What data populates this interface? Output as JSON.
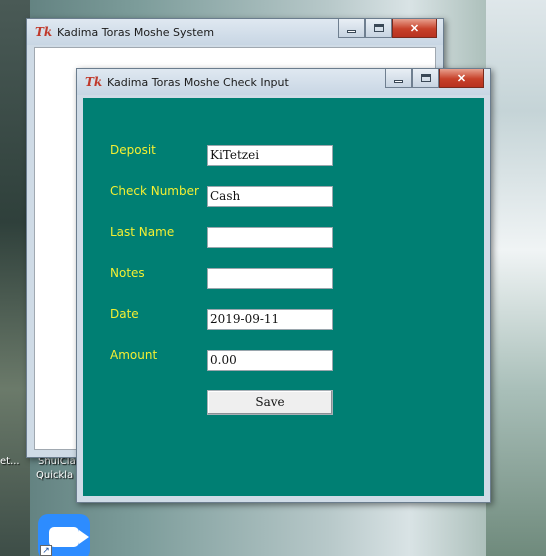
{
  "desktop": {
    "icon_labels": [
      "et...",
      "ShulCla",
      "Quickla"
    ]
  },
  "back_window": {
    "title": "Kadima Toras Moshe System"
  },
  "front_window": {
    "title": "Kadima Toras Moshe Check Input"
  },
  "form": {
    "deposit": {
      "label": "Deposit",
      "value": "KiTetzei"
    },
    "check_number": {
      "label": "Check Number",
      "value": "Cash"
    },
    "last_name": {
      "label": "Last Name",
      "value": ""
    },
    "notes": {
      "label": "Notes",
      "value": ""
    },
    "date": {
      "label": "Date",
      "value": "2019-09-11"
    },
    "amount": {
      "label": "Amount",
      "value": "0.00"
    },
    "save_label": "Save"
  },
  "colors": {
    "form_background": "#007f73",
    "label_text": "#f4ef32",
    "close_button": "#c7412a"
  }
}
